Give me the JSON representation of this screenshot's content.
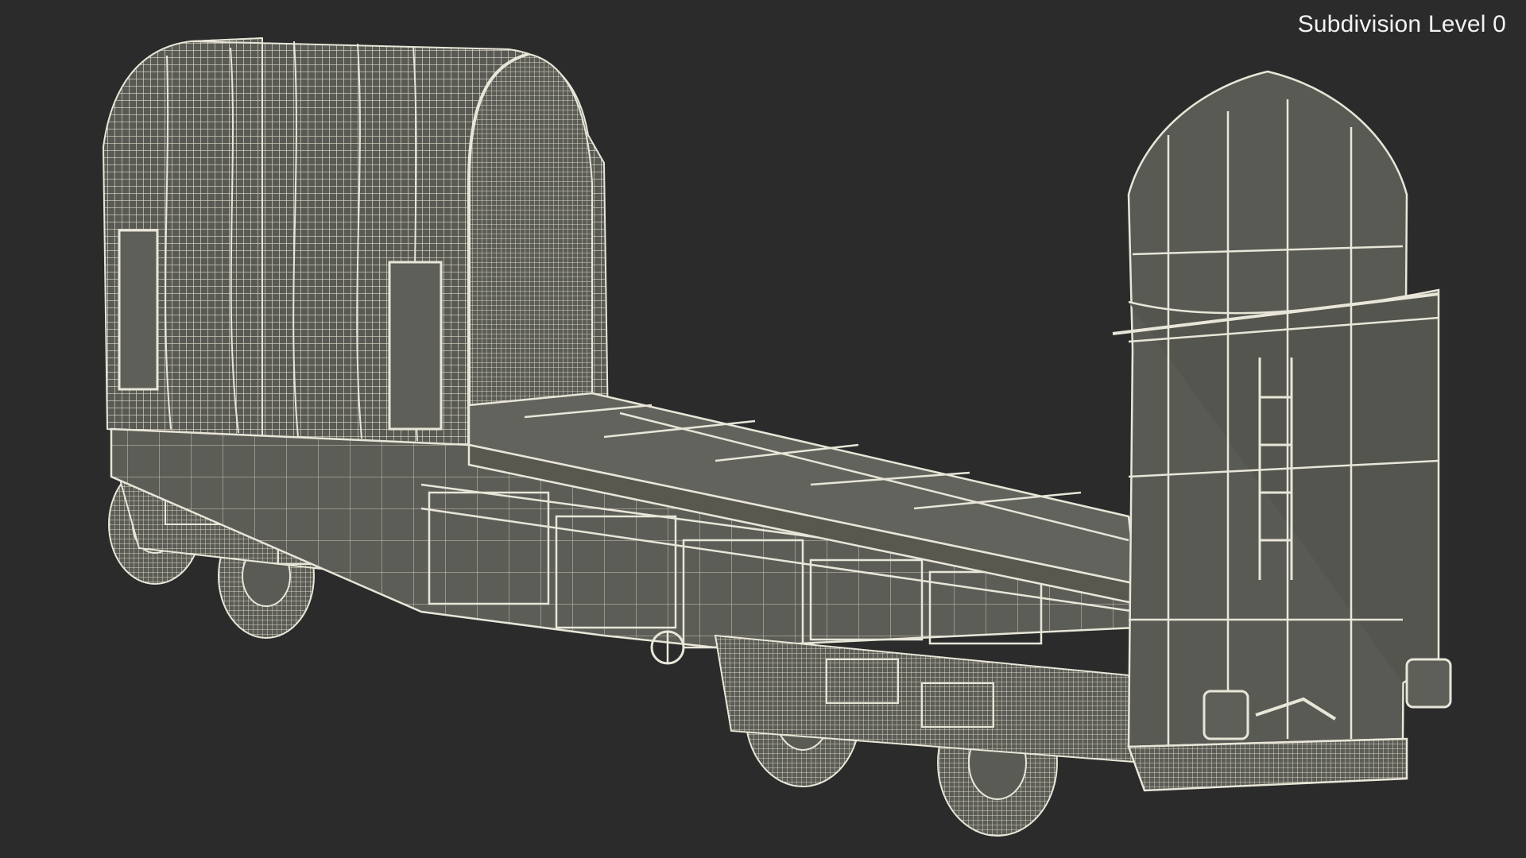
{
  "viewport": {
    "subdivision_label": "Subdivision Level 0",
    "background_color": "#2b2b2b",
    "wire_color": "#e8e6d8",
    "surface_color": "#5b5b55",
    "subject": "flat railway wagon with tarpaulin cover, wireframe render"
  }
}
